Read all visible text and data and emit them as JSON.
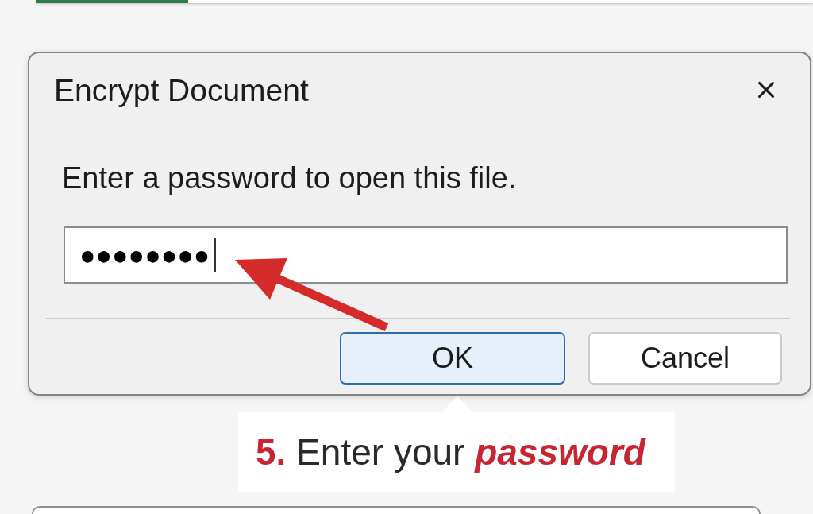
{
  "dialog": {
    "title": "Encrypt Document",
    "prompt": "Enter a password to open this file.",
    "password_field": {
      "value": "●●●●●●●●",
      "focused": true
    },
    "buttons": [
      {
        "label": "OK",
        "default": true
      },
      {
        "label": "Cancel",
        "default": false
      }
    ]
  },
  "callout": {
    "text": "**5.** Enter your *password*"
  }
}
